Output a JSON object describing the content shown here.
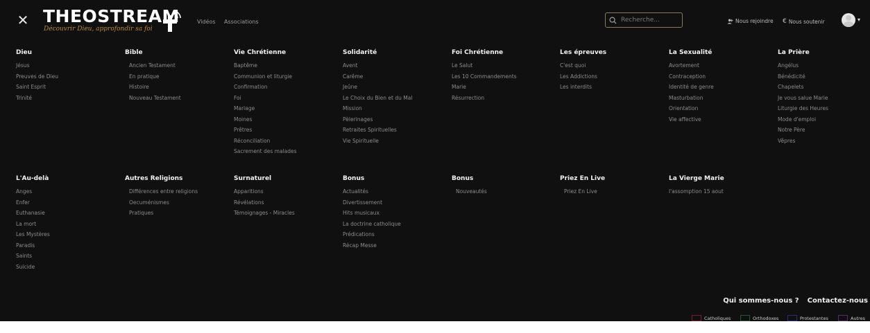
{
  "header": {
    "close_icon": "close-icon",
    "logo": {
      "title": "THEOSTREAM",
      "subtitle": "Découvrir Dieu, approfondir sa foi"
    },
    "nav": [
      "Vidéos",
      "Associations"
    ],
    "search": {
      "placeholder": "Recherche..."
    },
    "join_label": "Nous rejoindre",
    "support_label": "Nous soutenir"
  },
  "menu": [
    {
      "title": "Dieu",
      "items": [
        "Jésus",
        "Preuves de Dieu",
        "Saint Esprit",
        "Trinité"
      ]
    },
    {
      "title": "Bible",
      "items": [
        "Ancien Testament",
        "En pratique",
        "Histoire",
        "Nouveau Testament"
      ]
    },
    {
      "title": "Vie Chrétienne",
      "items": [
        "Baptême",
        "Communion et liturgie",
        "Confirmation",
        "Foi",
        "Mariage",
        "Moines",
        "Prêtres",
        "Réconciliation",
        "Sacrement des malades"
      ]
    },
    {
      "title": "Solidarité",
      "items": [
        "Avent",
        "Carême",
        "Jeûne",
        "Le Choix du Bien et du Mal",
        "Mission",
        "Pèlerinages",
        "Retraites Spirituelles",
        "Vie Spirituelle"
      ]
    },
    {
      "title": "Foi Chrétienne",
      "items": [
        "Le Salut",
        "Les 10 Commandements",
        "Marie",
        "Résurrection"
      ]
    },
    {
      "title": "Les épreuves",
      "items": [
        "C'est quoi",
        "Les Addictions",
        "Les interdits"
      ]
    },
    {
      "title": "La Sexualité",
      "items": [
        "Avortement",
        "Contraception",
        "Identité de genre",
        "Masturbation",
        "Orientation",
        "Vie affective"
      ]
    },
    {
      "title": "La Prière",
      "items": [
        "Angélus",
        "Bénédicité",
        "Chapelets",
        "Je vous salue Marie",
        "Liturgie des Heures",
        "Mode d'emploi",
        "Notre Père",
        "Vêpres"
      ]
    },
    {
      "title": "L'Au-delà",
      "items": [
        "Anges",
        "Enfer",
        "Euthanasie",
        "La mort",
        "Les Mystères",
        "Paradis",
        "Saints",
        "Suicide"
      ]
    },
    {
      "title": "Autres Religions",
      "items": [
        "Différences entre religions",
        "Oecuménismes",
        "Pratiques"
      ]
    },
    {
      "title": "Surnaturel",
      "items": [
        "Apparitions",
        "Révélations",
        "Témoignages - Miracles"
      ]
    },
    {
      "title": "Bonus",
      "items": [
        "Actualités",
        "Divertissement",
        "Hits musicaux",
        "La doctrine catholique",
        "Prédications",
        "Récap Messe"
      ]
    },
    {
      "title": "Bonus",
      "items": [
        "Nouveautés"
      ]
    },
    {
      "title": "Priez En Live",
      "items": [
        "Priez En Live"
      ]
    },
    {
      "title": "La Vierge Marie",
      "items": [
        "l'assomption 15 aout"
      ]
    }
  ],
  "footer": {
    "links": [
      "Qui sommes-nous ?",
      "Contactez-nous"
    ],
    "legend": [
      {
        "label": "Catholiques",
        "color": "#7a1f2a"
      },
      {
        "label": "Orthodoxes",
        "color": "#1f5a35"
      },
      {
        "label": "Protestantes",
        "color": "#27307a"
      },
      {
        "label": "Autres",
        "color": "#5a2a6e"
      }
    ]
  }
}
